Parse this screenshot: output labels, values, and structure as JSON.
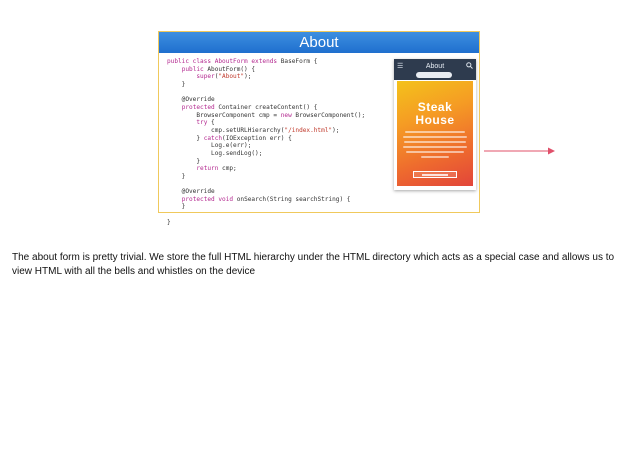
{
  "slide": {
    "title": "About",
    "code_lines": [
      [
        {
          "t": "public class AboutForm ",
          "c": "kw"
        },
        {
          "t": "extends",
          "c": "kw"
        },
        {
          "t": " BaseForm {"
        }
      ],
      [
        {
          "t": "    "
        },
        {
          "t": "public",
          "c": "kw"
        },
        {
          "t": " AboutForm() {"
        }
      ],
      [
        {
          "t": "        "
        },
        {
          "t": "super",
          "c": "kw"
        },
        {
          "t": "("
        },
        {
          "t": "\"About\"",
          "c": "str"
        },
        {
          "t": ");"
        }
      ],
      [
        {
          "t": "    }"
        }
      ],
      [
        {
          "t": ""
        }
      ],
      [
        {
          "t": "    @Override"
        }
      ],
      [
        {
          "t": "    "
        },
        {
          "t": "protected",
          "c": "kw"
        },
        {
          "t": " Container createContent() {"
        }
      ],
      [
        {
          "t": "        BrowserComponent cmp = "
        },
        {
          "t": "new",
          "c": "kw"
        },
        {
          "t": " BrowserComponent();"
        }
      ],
      [
        {
          "t": "        "
        },
        {
          "t": "try",
          "c": "kw"
        },
        {
          "t": " {"
        }
      ],
      [
        {
          "t": "            cmp.setURLHierarchy("
        },
        {
          "t": "\"/index.html\"",
          "c": "str"
        },
        {
          "t": ");"
        }
      ],
      [
        {
          "t": "        } "
        },
        {
          "t": "catch",
          "c": "kw"
        },
        {
          "t": "(IOException err) {"
        }
      ],
      [
        {
          "t": "            Log.e(err);"
        }
      ],
      [
        {
          "t": "            Log.sendLog();"
        }
      ],
      [
        {
          "t": "        }"
        }
      ],
      [
        {
          "t": "        "
        },
        {
          "t": "return",
          "c": "kw"
        },
        {
          "t": " cmp;"
        }
      ],
      [
        {
          "t": "    }"
        }
      ],
      [
        {
          "t": ""
        }
      ],
      [
        {
          "t": "    @Override"
        }
      ],
      [
        {
          "t": "    "
        },
        {
          "t": "protected void",
          "c": "kw"
        },
        {
          "t": " onSearch(String searchString) {"
        }
      ],
      [
        {
          "t": "    }"
        }
      ],
      [
        {
          "t": ""
        }
      ],
      [
        {
          "t": "}"
        }
      ]
    ],
    "phone": {
      "menu_icon": "hamburger-icon",
      "title": "About",
      "search_icon": "search-icon",
      "hero_title_line1": "Steak",
      "hero_title_line2": "House"
    },
    "colors": {
      "header": "#2a7bd8",
      "border": "#f0c95c",
      "arrow": "#e0506a",
      "keyword": "#b3288f",
      "string": "#c0392b"
    }
  },
  "caption": "The about form is pretty trivial. We store the full HTML hierarchy under the HTML directory which acts as a special case and allows us to view HTML with all the bells and whistles on the device"
}
